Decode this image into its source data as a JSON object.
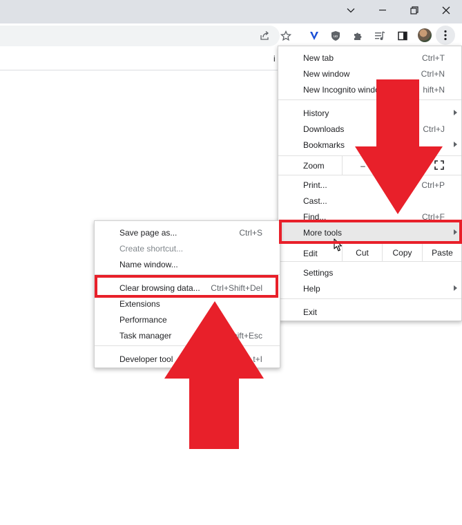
{
  "window_controls": {
    "tab_search_icon": "chevron-down-icon",
    "minimize_icon": "minimize-icon",
    "restore_icon": "restore-icon",
    "close_icon": "close-icon"
  },
  "toolbar": {
    "icons": [
      "share-icon",
      "star-icon",
      "vpn-extension-icon",
      "ublock-icon",
      "puzzle-icon",
      "media-icon",
      "side-panel-icon",
      "avatar",
      "kebab-menu-icon"
    ],
    "truncated_bookmark_text": "i"
  },
  "main_menu": {
    "items": [
      {
        "label": "New tab",
        "shortcut": "Ctrl+T"
      },
      {
        "label": "New window",
        "shortcut": "Ctrl+N"
      },
      {
        "label": "New Incognito windo",
        "shortcut": "hift+N"
      },
      {
        "label": "History",
        "shortcut": ""
      },
      {
        "label": "Downloads",
        "shortcut": "Ctrl+J"
      },
      {
        "label": "Bookmarks",
        "shortcut": ""
      },
      {
        "label": "Zoom",
        "shortcut": ""
      },
      {
        "label": "Print...",
        "shortcut": "Ctrl+P"
      },
      {
        "label": "Cast...",
        "shortcut": ""
      },
      {
        "label": "Find...",
        "shortcut": "Ctrl+F"
      },
      {
        "label": "More tools",
        "shortcut": ""
      },
      {
        "label": "Edit",
        "shortcut": ""
      },
      {
        "label": "Settings",
        "shortcut": ""
      },
      {
        "label": "Help",
        "shortcut": ""
      },
      {
        "label": "Exit",
        "shortcut": ""
      }
    ],
    "zoom_minus": "–",
    "edit_buttons": {
      "cut": "Cut",
      "copy": "Copy",
      "paste": "Paste"
    }
  },
  "more_tools_menu": {
    "items": [
      {
        "label": "Save page as...",
        "shortcut": "Ctrl+S",
        "disabled": false
      },
      {
        "label": "Create shortcut...",
        "shortcut": "",
        "disabled": true
      },
      {
        "label": "Name window...",
        "shortcut": "",
        "disabled": false
      },
      {
        "label": "Clear browsing data...",
        "shortcut": "Ctrl+Shift+Del",
        "disabled": false
      },
      {
        "label": "Extensions",
        "shortcut": "",
        "disabled": false
      },
      {
        "label": "Performance",
        "shortcut": "",
        "disabled": false
      },
      {
        "label": "Task manager",
        "shortcut": "hift+Esc",
        "disabled": false
      },
      {
        "label": "Developer tool",
        "shortcut": "t+I",
        "disabled": false
      }
    ]
  },
  "annotation_color": "#e8202a"
}
